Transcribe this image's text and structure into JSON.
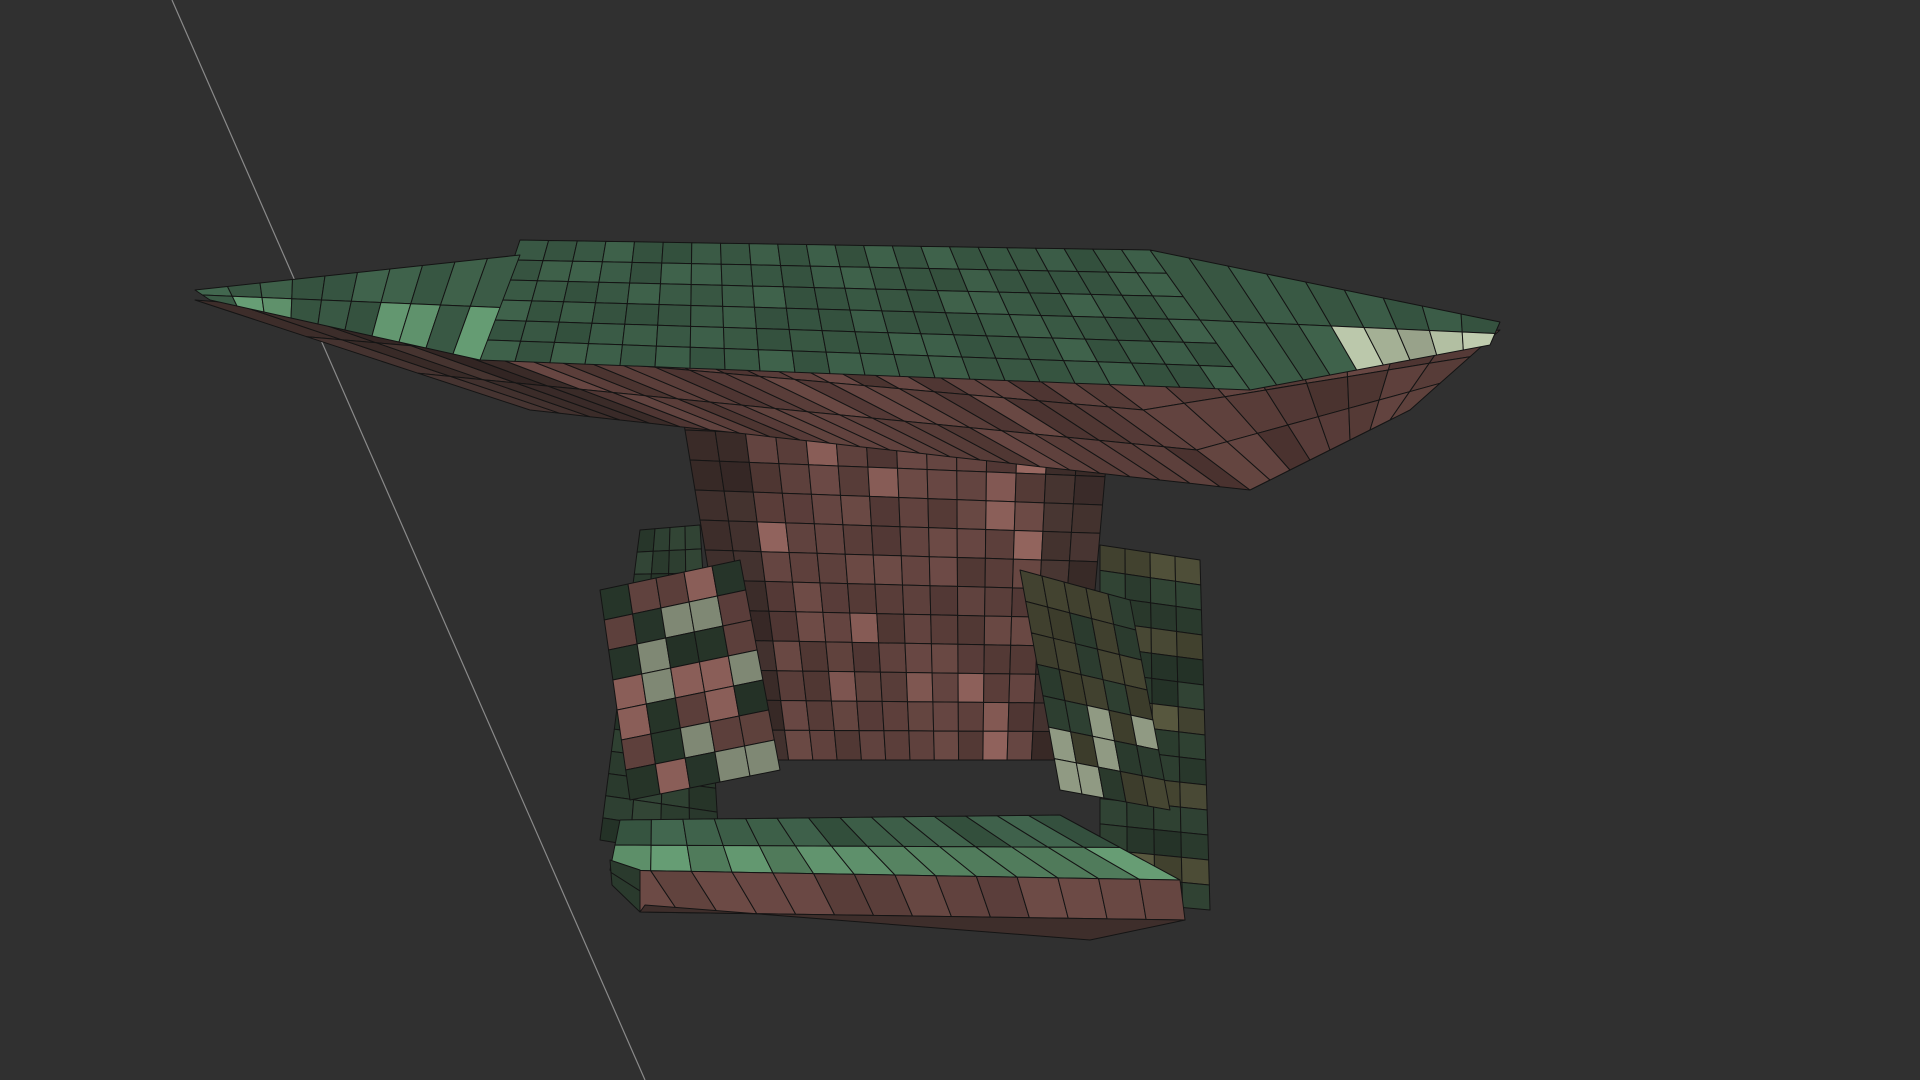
{
  "viewport": {
    "background_color": "#303030",
    "axis_line_color": "#8a8a8a",
    "wire_color": "#141414"
  },
  "mesh": {
    "object": "anvil",
    "shading": "face-orientation",
    "palette": {
      "top_face": "#3a5a45",
      "top_face_light": "#5a8a66",
      "side_face": "#5c3f3b",
      "side_face_light": "#8a5e58",
      "highlight": "#a9b59a",
      "shadow_green": "#2a3a2d",
      "shadow_brown": "#3e2e2b",
      "olive": "#4a4a35"
    }
  }
}
